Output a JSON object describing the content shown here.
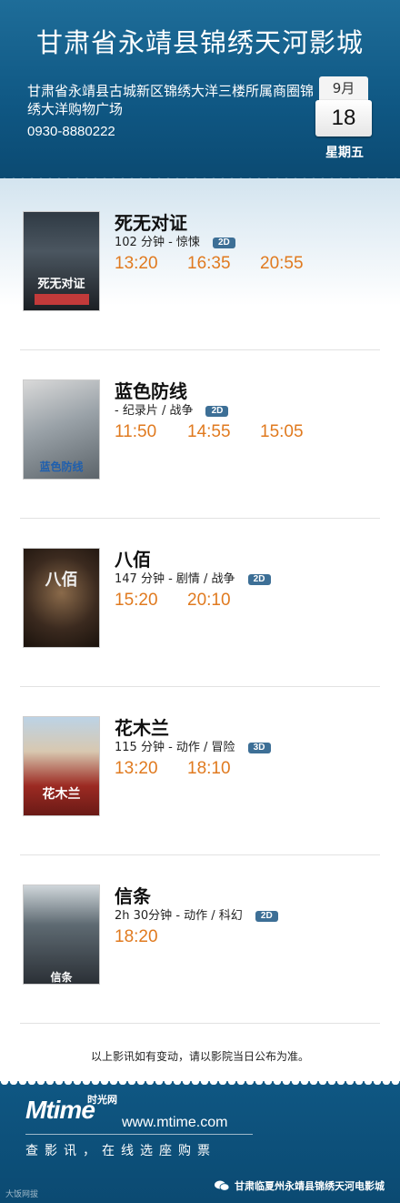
{
  "cinema": {
    "name": "甘肃省永靖县锦绣天河影城",
    "address": "甘肃省永靖县古城新区锦绣大洋三楼所属商圈锦绣大洋购物广场",
    "phone": "0930-8880222"
  },
  "date": {
    "month": "9月",
    "day": "18",
    "weekday": "星期五"
  },
  "movies": [
    {
      "title": "死无对证",
      "meta": "102 分钟 - 惊悚",
      "format": "2D",
      "times": [
        "13:20",
        "16:35",
        "20:55"
      ],
      "poster_text": "死无对证"
    },
    {
      "title": "蓝色防线",
      "meta": "- 纪录片 / 战争",
      "format": "2D",
      "times": [
        "11:50",
        "14:55",
        "15:05"
      ],
      "poster_text": "蓝色防线"
    },
    {
      "title": "八佰",
      "meta": "147 分钟 - 剧情 / 战争",
      "format": "2D",
      "times": [
        "15:20",
        "20:10"
      ],
      "poster_text": "八佰"
    },
    {
      "title": "花木兰",
      "meta": "115 分钟 - 动作 / 冒险",
      "format": "3D",
      "times": [
        "13:20",
        "18:10"
      ],
      "poster_text": "花木兰"
    },
    {
      "title": "信条",
      "meta": "2h 30分钟 - 动作 / 科幻",
      "format": "2D",
      "times": [
        "18:20"
      ],
      "poster_text": "信条"
    }
  ],
  "notice": "以上影讯如有变动，请以影院当日公布为准。",
  "footer": {
    "logo_text": "Mtime",
    "logo_cn": "时光网",
    "url": "www.mtime.com",
    "slogan": "查影讯，在线选座购票",
    "wechat": "甘肃临夏州永靖县锦绣天河电影城",
    "corner": "大饭网拔"
  },
  "colors": {
    "header": "#0f5783",
    "showtime": "#e07a1f",
    "badge": "#3d6f96"
  }
}
